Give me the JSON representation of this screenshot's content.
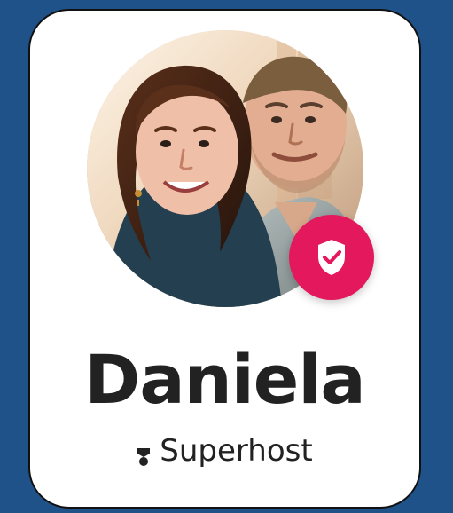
{
  "profile": {
    "name": "Daniela",
    "badge_label": "Superhost"
  },
  "icons": {
    "avatar": "profile-photo",
    "verified": "verified-shield-check-icon",
    "superhost": "superhost-icon"
  },
  "colors": {
    "background": "#1f5289",
    "card": "#ffffff",
    "border": "#111111",
    "accent": "#e3185d",
    "text": "#222222"
  }
}
